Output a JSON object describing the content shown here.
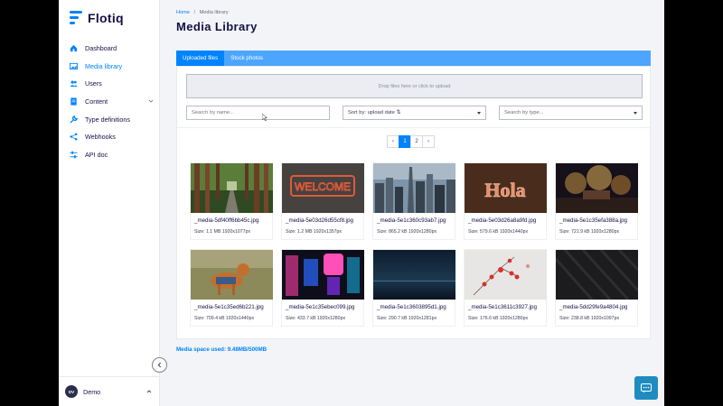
{
  "app": {
    "brand": "Flotiq",
    "accent": "#0083fc",
    "dark": "#141046"
  },
  "sidebar": {
    "items": [
      {
        "label": "Dashboard",
        "icon": "home-icon",
        "active": false
      },
      {
        "label": "Media library",
        "icon": "image-icon",
        "active": true
      },
      {
        "label": "Users",
        "icon": "users-icon",
        "active": false
      },
      {
        "label": "Content",
        "icon": "document-icon",
        "active": false,
        "has_children": true
      },
      {
        "label": "Type definitions",
        "icon": "wrench-icon",
        "active": false
      },
      {
        "label": "Webhooks",
        "icon": "share-icon",
        "active": false
      },
      {
        "label": "API doc",
        "icon": "sliders-icon",
        "active": false
      }
    ],
    "user": {
      "initials": "DV",
      "name": "Demo"
    }
  },
  "header": {
    "breadcrumb": {
      "home": "Home",
      "separator": "/",
      "current": "Media library"
    },
    "title": "Media Library"
  },
  "tabs": [
    {
      "label": "Uploaded files",
      "active": true
    },
    {
      "label": "Stock photos",
      "active": false
    }
  ],
  "dropzone": {
    "text": "Drop files here or click to upload"
  },
  "filters": {
    "search_placeholder": "Search by name...",
    "sort_label": "Sort by: upload date ⇅",
    "type_placeholder": "Search by type..."
  },
  "pagination": {
    "prev": "‹",
    "pages": [
      "1",
      "2"
    ],
    "current": "1",
    "next": "›"
  },
  "media": [
    {
      "name": "_media-5df40ff6bb45c.jpg",
      "size": "Size: 1.1 MB 1920x1077px",
      "thumb": "forest-road"
    },
    {
      "name": "_media-5e03d26d55cf8.jpg",
      "size": "Size: 1.2 MB 1920x1357px",
      "thumb": "welcome-sign"
    },
    {
      "name": "_media-5e1c360c93ab7.jpg",
      "size": "Size: 865.2 kB 1920x1280px",
      "thumb": "city-skyline"
    },
    {
      "name": "_media-5e03d26a8a9fd.jpg",
      "size": "Size: 579.6 kB 1920x1440px",
      "thumb": "hola-sign"
    },
    {
      "name": "_media-5e1c35efa388a.jpg",
      "size": "Size: 721.9 kB 1920x1280px",
      "thumb": "fireworks"
    },
    {
      "name": "_media-5e1c35ed6b221.jpg",
      "size": "Size: 709.4 kB 1920x1440px",
      "thumb": "dog-field"
    },
    {
      "name": "_media-5e1c35ebec099.jpg",
      "size": "Size: 433.7 kB 1920x1280px",
      "thumb": "neon-arcade"
    },
    {
      "name": "_media-5e1c3603895d1.jpg",
      "size": "Size: 290.7 kB 1920x1281px",
      "thumb": "dark-horizon"
    },
    {
      "name": "_media-5e1c3611c3927.jpg",
      "size": "Size: 176.6 kB 1920x1280px",
      "thumb": "red-berries"
    },
    {
      "name": "_media-5dd29fe9a4804.jpg",
      "size": "Size: 238.8 kB 1920x1097px",
      "thumb": "dark-fabric"
    }
  ],
  "usage": "Media space used: 9.48MB/500MB"
}
